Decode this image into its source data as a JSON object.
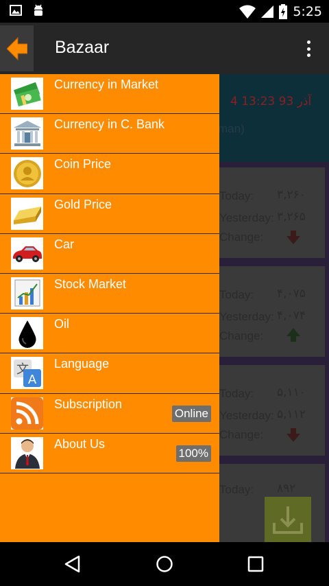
{
  "status_bar": {
    "time": "5:25"
  },
  "app_bar": {
    "title": "Bazaar"
  },
  "background": {
    "header": {
      "date": "4 آذر 93  13:23",
      "unit": "man)"
    },
    "cards": [
      {
        "today_label": "Today:",
        "today_value": "۳,۲۶۰",
        "yesterday_label": "Yesterday:",
        "yesterday_value": "۳,۲۶۵",
        "change_label": "Change:",
        "trend": "down"
      },
      {
        "today_label": "Today:",
        "today_value": "۴,۰۷۵",
        "yesterday_label": "Yesterday:",
        "yesterday_value": "۴,۰۷۴",
        "change_label": "Change:",
        "trend": "up"
      },
      {
        "today_label": "Today:",
        "today_value": "۵,۱۱۰",
        "yesterday_label": "Yesterday:",
        "yesterday_value": "۵,۱۱۲",
        "change_label": "Change:",
        "trend": "down"
      },
      {
        "today_label": "Today:",
        "today_value": "۸۹۲"
      }
    ]
  },
  "drawer": {
    "items": [
      {
        "label": "Currency in Market",
        "icon": "money-icon"
      },
      {
        "label": "Currency in C. Bank",
        "icon": "bank-icon"
      },
      {
        "label": "Coin Price",
        "icon": "coin-icon"
      },
      {
        "label": "Gold Price",
        "icon": "gold-bar-icon"
      },
      {
        "label": "Car",
        "icon": "car-icon"
      },
      {
        "label": "Stock Market",
        "icon": "chart-icon"
      },
      {
        "label": "Oil",
        "icon": "oil-drop-icon"
      },
      {
        "label": "Language",
        "icon": "translate-icon"
      },
      {
        "label": "Subscription",
        "icon": "rss-icon",
        "badge": "Online"
      },
      {
        "label": "About Us",
        "icon": "person-icon",
        "badge": "100%"
      }
    ]
  },
  "colors": {
    "drawer": "#ff8c00",
    "app_bar": "#262626",
    "up": "#2e8b2e",
    "down": "#c0141a"
  }
}
